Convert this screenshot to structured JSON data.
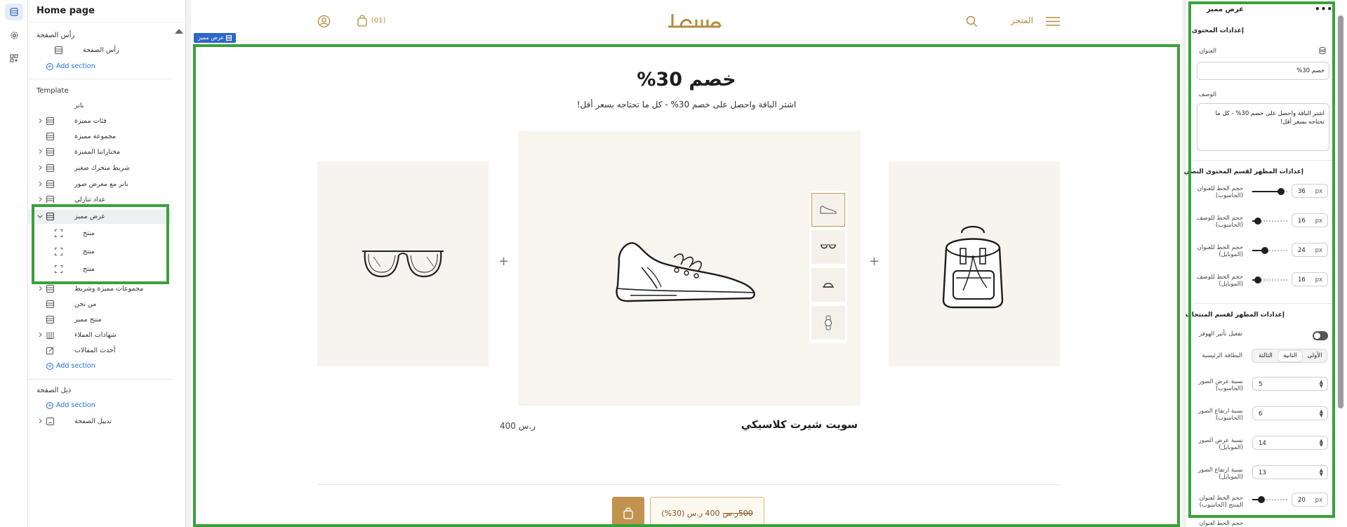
{
  "rail": {
    "icons": [
      "layout-icon",
      "gear-icon",
      "blocks-icon"
    ]
  },
  "tree": {
    "title": "Home page",
    "header_group": "رأس الصفحة",
    "header_item": "رأس الصفحة",
    "add_section": "Add section",
    "template_group": "Template",
    "items": [
      "بانر",
      "فئات مميزة",
      "مجموعة مميزة",
      "مختاراتنا المميزة",
      "شريط متحرك صغير",
      "بانر مع معرض صور",
      "عداد تنازلي",
      "عرض مميز",
      "منتج",
      "منتج",
      "منتج",
      "مجموعات مميزة وشريط",
      "من نحن",
      "منتج مميز",
      "شهادات العملاء",
      "أحدث المقالات"
    ],
    "footer_group": "ذيل الصفحة",
    "footer_item": "تذييل الصفحة"
  },
  "store": {
    "logo": "مسطا",
    "store_link": "المتجر",
    "cart_count": "(01)",
    "section_badge": "عرض مميز",
    "offer_title": "خصم 30%",
    "offer_desc": "اشتر الباقة واحصل على خصم 30% - كل ما تحتاجه بسعر أقل!",
    "product_name": "سويت شيرت كلاسيكي",
    "product_price": "400 ر.س",
    "old_price": "500ر.س",
    "new_price": "400 ر.س (30%)"
  },
  "settings": {
    "section_title": "عرض مميز",
    "content_settings": "إعدادات المحتوى",
    "title_label": "العنوان",
    "title_value": "خصم 30%",
    "desc_label": "الوصف",
    "desc_value": "اشتر الباقة واحصل على خصم 30% - كل ما تحتاجه بسعر أقل!",
    "text_appearance": "إعدادات المظهر لقسم المحتوى النصي",
    "font_rows": [
      {
        "label": "حجم الخط للعنوان (الحاسوب)",
        "value": "36",
        "unit": "px",
        "level": 0.78
      },
      {
        "label": "حجم الخط للوصف (الحاسوب)",
        "value": "16",
        "unit": "px",
        "level": 0.15
      },
      {
        "label": "حجم الخط للعنوان (الموبايل)",
        "value": "24",
        "unit": "px",
        "level": 0.35
      },
      {
        "label": "حجم الخط للوصف (الموبايل)",
        "value": "16",
        "unit": "px",
        "level": 0.15
      }
    ],
    "products_appearance": "إعدادات المظهر لقسم المنتجات",
    "hover_label": "تفعيل تأثير الهوفر",
    "main_card_label": "البطاقة الرئيسية",
    "main_card_options": [
      "الأولى",
      "الثانية",
      "الثالثة"
    ],
    "ratio_rows": [
      {
        "label": "نسبة عرض الصور (الحاسوب)",
        "value": "5"
      },
      {
        "label": "نسبة ارتفاع الصور (الحاسوب)",
        "value": "6"
      },
      {
        "label": "نسبة عرض الصور (الموبايل)",
        "value": "14"
      },
      {
        "label": "نسبة ارتفاع الصور (الموبايل)",
        "value": "13"
      }
    ],
    "product_title_font": {
      "label": "حجم الخط لعنوان المنتج (الحاسوب)",
      "value": "20",
      "unit": "px",
      "level": 0.25
    },
    "product_title_font_mobile": "حجم الخط لعنوان"
  }
}
